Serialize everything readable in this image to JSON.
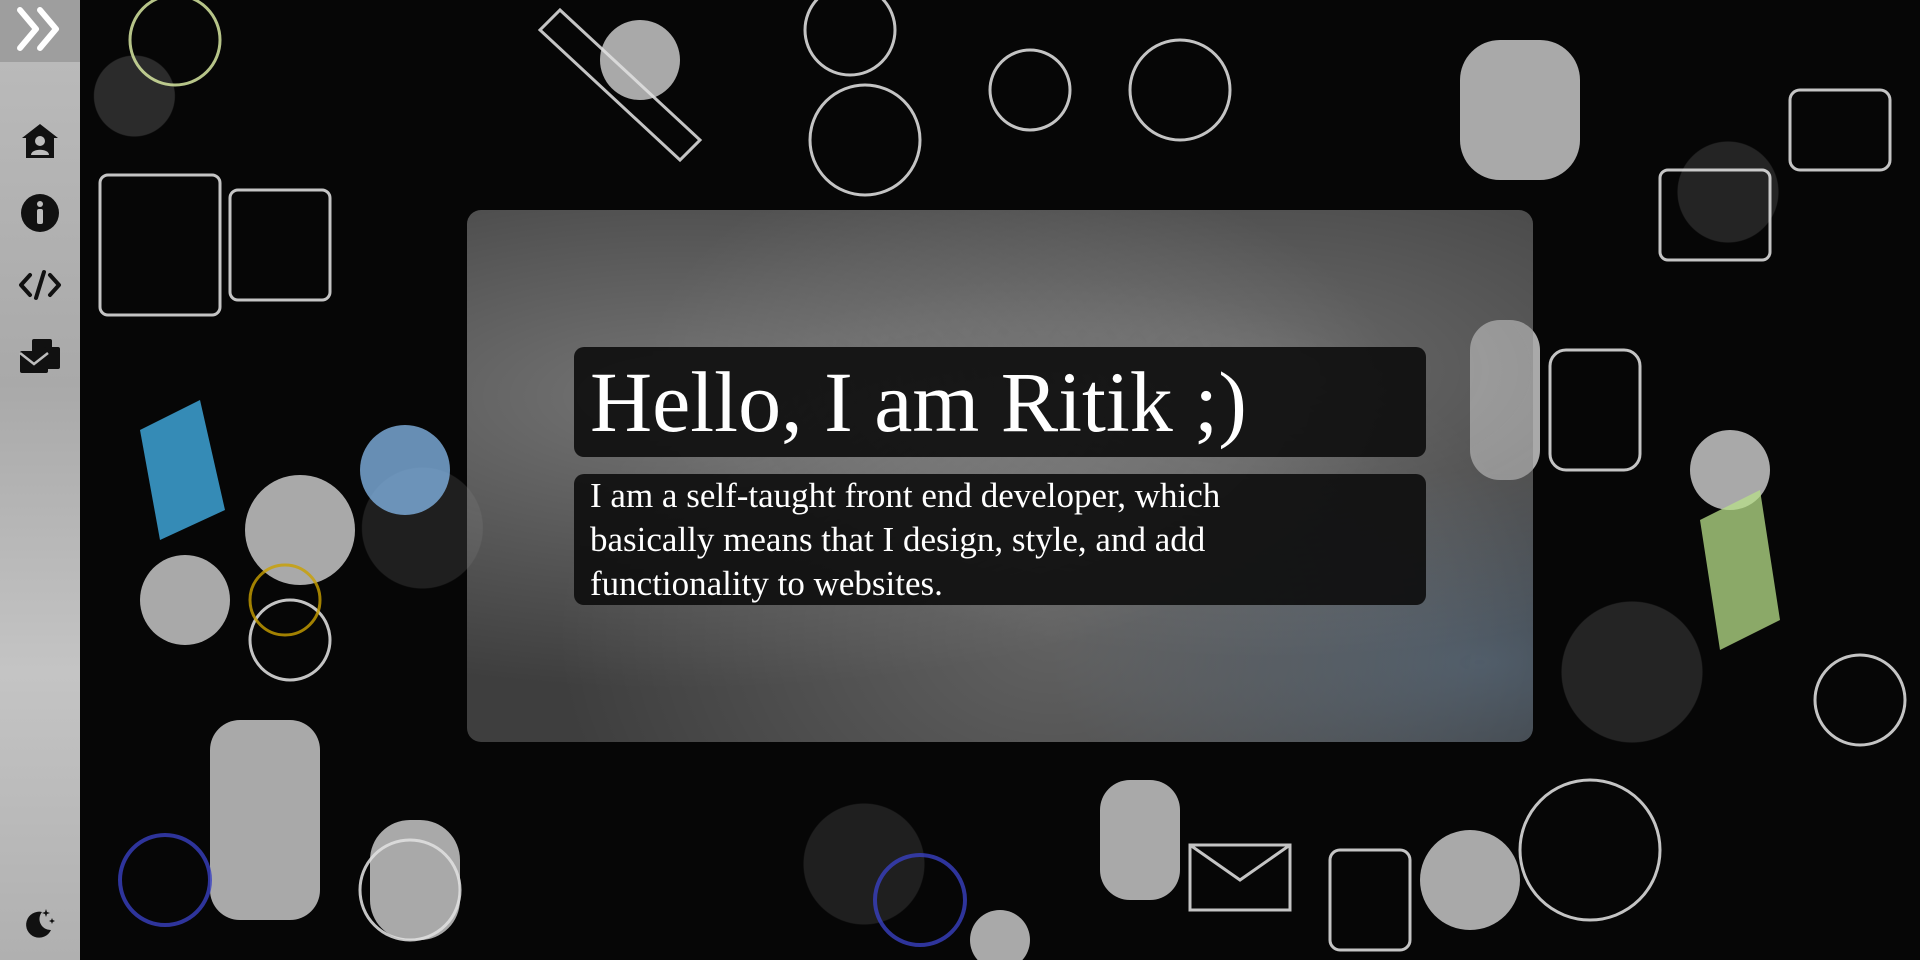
{
  "sidebar": {
    "toggle_icon": "double-chevron-right-icon",
    "items": [
      {
        "id": "home",
        "icon": "home-user-icon"
      },
      {
        "id": "about",
        "icon": "info-icon"
      },
      {
        "id": "projects",
        "icon": "code-icon"
      },
      {
        "id": "contact",
        "icon": "mail-box-icon"
      }
    ],
    "theme_icon": "moon-stars-icon"
  },
  "hero": {
    "title": "Hello, I am Ritik ;)",
    "description": "I am a self-taught front end developer, which basically means that I design, style, and add functionality to websites."
  },
  "colors": {
    "sidebar_bg": "#bdbdbd",
    "toggle_bg": "#9e9e9e",
    "icon_color": "#111111",
    "text_bg": "#0c0c0c",
    "text_color": "#ffffff"
  }
}
